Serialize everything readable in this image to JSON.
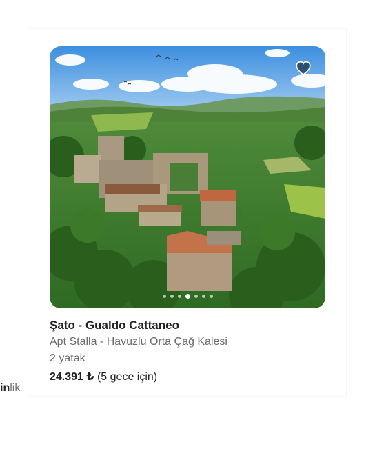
{
  "listing": {
    "title": "Şato - Gualdo Cattaneo",
    "subtitle": "Apt Stalla - Havuzlu Orta Çağ Kalesi",
    "beds": "2 yatak",
    "price": "24.391 ₺",
    "price_note": "(5 gece için)",
    "photo_count": 7,
    "active_photo_index": 3,
    "is_favorited": false
  },
  "brand": {
    "bold_text": "in",
    "light_text": "lik"
  },
  "icons": {
    "favorite": "heart-icon"
  },
  "colors": {
    "text_primary": "#222222",
    "text_secondary": "#6a6a6a",
    "heart_fill": "rgba(0,0,0,0.5)",
    "heart_stroke": "#ffffff"
  }
}
